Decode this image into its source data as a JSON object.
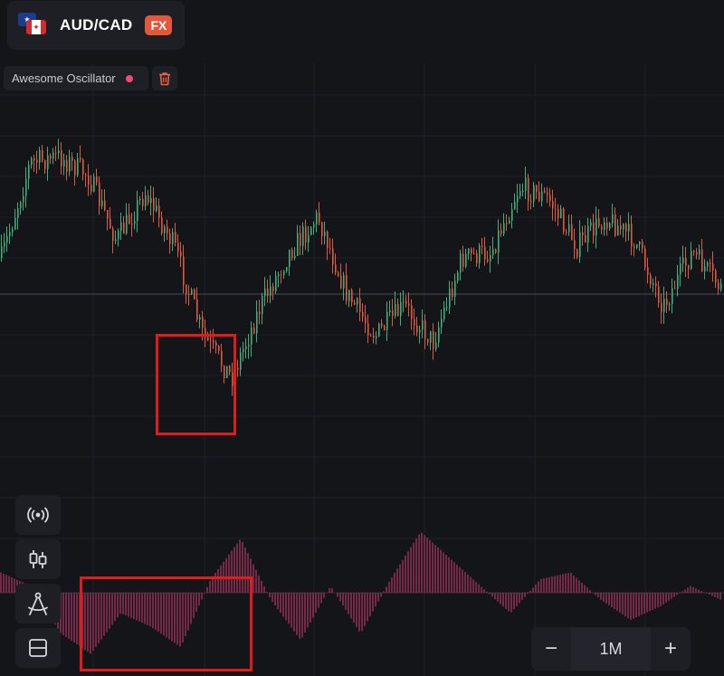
{
  "instrument": {
    "pair": "AUD/CAD",
    "badge": "FX",
    "flags": [
      "australia-flag",
      "canada-flag"
    ]
  },
  "indicator": {
    "name": "Awesome Oscillator",
    "dot_color": "#ee4a7a"
  },
  "toolbar": [
    "broadcast-icon",
    "candlestick-icon",
    "drawing-compass-icon",
    "layout-split-icon"
  ],
  "zoom": {
    "minus": "−",
    "timeframe": "1M",
    "plus": "+"
  },
  "colors": {
    "background": "#141519",
    "bull": "#3fae7d",
    "bear": "#e0593f",
    "oscillator": "#b33a64",
    "highlight": "#e01c1c"
  },
  "chart_data": {
    "type": "candlestick",
    "title": "",
    "price_trend": [
      0.56,
      0.88,
      0.9,
      0.84,
      0.62,
      0.78,
      0.6,
      0.3,
      0.16,
      0.4,
      0.58,
      0.7,
      0.44,
      0.3,
      0.4,
      0.28,
      0.56,
      0.58,
      0.8,
      0.76,
      0.6,
      0.7,
      0.62,
      0.4,
      0.58,
      0.46
    ],
    "oscillator_trend": [
      0.3,
      0.1,
      -0.6,
      -0.9,
      -0.3,
      -0.5,
      -0.8,
      0.2,
      0.8,
      -0.1,
      -0.7,
      0.1,
      -0.6,
      0.2,
      0.9,
      0.5,
      0.1,
      -0.3,
      0.2,
      0.3,
      -0.1,
      -0.4,
      -0.2,
      0.1,
      -0.1
    ],
    "oscillator_series": "Awesome Oscillator",
    "grid": true
  }
}
